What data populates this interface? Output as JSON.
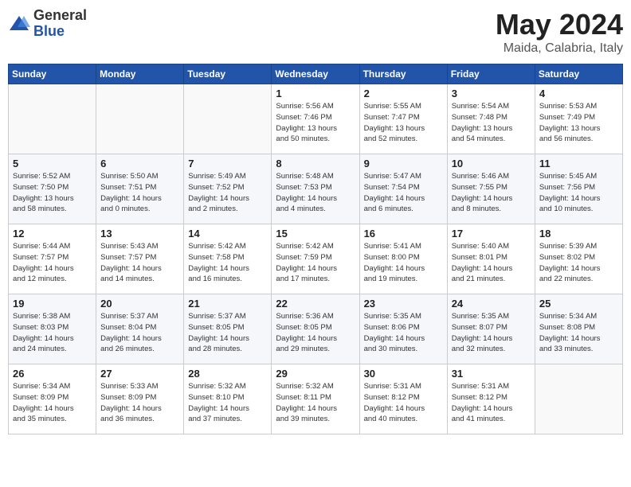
{
  "logo": {
    "general": "General",
    "blue": "Blue"
  },
  "title": "May 2024",
  "location": "Maida, Calabria, Italy",
  "days_of_week": [
    "Sunday",
    "Monday",
    "Tuesday",
    "Wednesday",
    "Thursday",
    "Friday",
    "Saturday"
  ],
  "weeks": [
    [
      {
        "day": "",
        "info": ""
      },
      {
        "day": "",
        "info": ""
      },
      {
        "day": "",
        "info": ""
      },
      {
        "day": "1",
        "info": "Sunrise: 5:56 AM\nSunset: 7:46 PM\nDaylight: 13 hours\nand 50 minutes."
      },
      {
        "day": "2",
        "info": "Sunrise: 5:55 AM\nSunset: 7:47 PM\nDaylight: 13 hours\nand 52 minutes."
      },
      {
        "day": "3",
        "info": "Sunrise: 5:54 AM\nSunset: 7:48 PM\nDaylight: 13 hours\nand 54 minutes."
      },
      {
        "day": "4",
        "info": "Sunrise: 5:53 AM\nSunset: 7:49 PM\nDaylight: 13 hours\nand 56 minutes."
      }
    ],
    [
      {
        "day": "5",
        "info": "Sunrise: 5:52 AM\nSunset: 7:50 PM\nDaylight: 13 hours\nand 58 minutes."
      },
      {
        "day": "6",
        "info": "Sunrise: 5:50 AM\nSunset: 7:51 PM\nDaylight: 14 hours\nand 0 minutes."
      },
      {
        "day": "7",
        "info": "Sunrise: 5:49 AM\nSunset: 7:52 PM\nDaylight: 14 hours\nand 2 minutes."
      },
      {
        "day": "8",
        "info": "Sunrise: 5:48 AM\nSunset: 7:53 PM\nDaylight: 14 hours\nand 4 minutes."
      },
      {
        "day": "9",
        "info": "Sunrise: 5:47 AM\nSunset: 7:54 PM\nDaylight: 14 hours\nand 6 minutes."
      },
      {
        "day": "10",
        "info": "Sunrise: 5:46 AM\nSunset: 7:55 PM\nDaylight: 14 hours\nand 8 minutes."
      },
      {
        "day": "11",
        "info": "Sunrise: 5:45 AM\nSunset: 7:56 PM\nDaylight: 14 hours\nand 10 minutes."
      }
    ],
    [
      {
        "day": "12",
        "info": "Sunrise: 5:44 AM\nSunset: 7:57 PM\nDaylight: 14 hours\nand 12 minutes."
      },
      {
        "day": "13",
        "info": "Sunrise: 5:43 AM\nSunset: 7:57 PM\nDaylight: 14 hours\nand 14 minutes."
      },
      {
        "day": "14",
        "info": "Sunrise: 5:42 AM\nSunset: 7:58 PM\nDaylight: 14 hours\nand 16 minutes."
      },
      {
        "day": "15",
        "info": "Sunrise: 5:42 AM\nSunset: 7:59 PM\nDaylight: 14 hours\nand 17 minutes."
      },
      {
        "day": "16",
        "info": "Sunrise: 5:41 AM\nSunset: 8:00 PM\nDaylight: 14 hours\nand 19 minutes."
      },
      {
        "day": "17",
        "info": "Sunrise: 5:40 AM\nSunset: 8:01 PM\nDaylight: 14 hours\nand 21 minutes."
      },
      {
        "day": "18",
        "info": "Sunrise: 5:39 AM\nSunset: 8:02 PM\nDaylight: 14 hours\nand 22 minutes."
      }
    ],
    [
      {
        "day": "19",
        "info": "Sunrise: 5:38 AM\nSunset: 8:03 PM\nDaylight: 14 hours\nand 24 minutes."
      },
      {
        "day": "20",
        "info": "Sunrise: 5:37 AM\nSunset: 8:04 PM\nDaylight: 14 hours\nand 26 minutes."
      },
      {
        "day": "21",
        "info": "Sunrise: 5:37 AM\nSunset: 8:05 PM\nDaylight: 14 hours\nand 28 minutes."
      },
      {
        "day": "22",
        "info": "Sunrise: 5:36 AM\nSunset: 8:05 PM\nDaylight: 14 hours\nand 29 minutes."
      },
      {
        "day": "23",
        "info": "Sunrise: 5:35 AM\nSunset: 8:06 PM\nDaylight: 14 hours\nand 30 minutes."
      },
      {
        "day": "24",
        "info": "Sunrise: 5:35 AM\nSunset: 8:07 PM\nDaylight: 14 hours\nand 32 minutes."
      },
      {
        "day": "25",
        "info": "Sunrise: 5:34 AM\nSunset: 8:08 PM\nDaylight: 14 hours\nand 33 minutes."
      }
    ],
    [
      {
        "day": "26",
        "info": "Sunrise: 5:34 AM\nSunset: 8:09 PM\nDaylight: 14 hours\nand 35 minutes."
      },
      {
        "day": "27",
        "info": "Sunrise: 5:33 AM\nSunset: 8:09 PM\nDaylight: 14 hours\nand 36 minutes."
      },
      {
        "day": "28",
        "info": "Sunrise: 5:32 AM\nSunset: 8:10 PM\nDaylight: 14 hours\nand 37 minutes."
      },
      {
        "day": "29",
        "info": "Sunrise: 5:32 AM\nSunset: 8:11 PM\nDaylight: 14 hours\nand 39 minutes."
      },
      {
        "day": "30",
        "info": "Sunrise: 5:31 AM\nSunset: 8:12 PM\nDaylight: 14 hours\nand 40 minutes."
      },
      {
        "day": "31",
        "info": "Sunrise: 5:31 AM\nSunset: 8:12 PM\nDaylight: 14 hours\nand 41 minutes."
      },
      {
        "day": "",
        "info": ""
      }
    ]
  ]
}
